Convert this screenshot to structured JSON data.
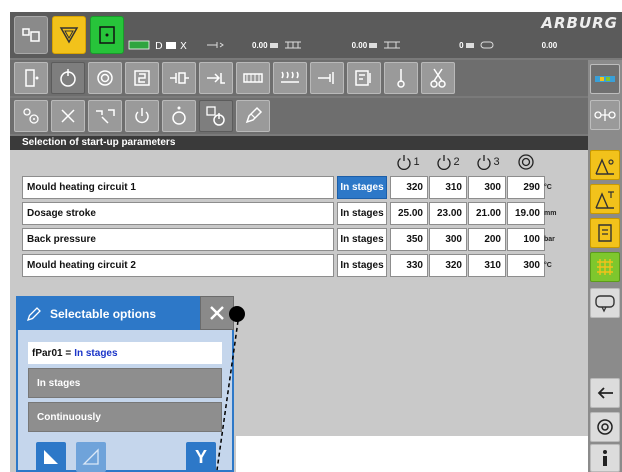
{
  "brand": "ARBURG",
  "status": {
    "v1": "0.00",
    "v2": "0.00",
    "v3": "0",
    "v4": "0.00"
  },
  "panel": {
    "title": "Selection of start-up parameters",
    "columns": [
      "1",
      "2",
      "3"
    ]
  },
  "rows": [
    {
      "name": "Mould heating circuit 1",
      "mode": "In stages",
      "v1": "320",
      "v2": "310",
      "v3": "300",
      "v4": "290",
      "unit": "°C"
    },
    {
      "name": "Dosage stroke",
      "mode": "In stages",
      "v1": "25.00",
      "v2": "23.00",
      "v3": "21.00",
      "v4": "19.00",
      "unit": "mm"
    },
    {
      "name": "Back pressure",
      "mode": "In stages",
      "v1": "350",
      "v2": "300",
      "v3": "200",
      "v4": "100",
      "unit": "bar"
    },
    {
      "name": "Mould heating circuit 2",
      "mode": "In stages",
      "v1": "330",
      "v2": "320",
      "v3": "310",
      "v4": "300",
      "unit": "°C"
    }
  ],
  "dialog": {
    "title": "Selectable options",
    "field_label": "fPar01 =",
    "field_value": "In stages",
    "options": [
      "In stages",
      "Continuously"
    ],
    "confirm_label": "Y"
  },
  "colors": {
    "accent_blue": "#2d78c8",
    "mode_manual": "#f2c21b",
    "mode_auto": "#27c43a"
  }
}
